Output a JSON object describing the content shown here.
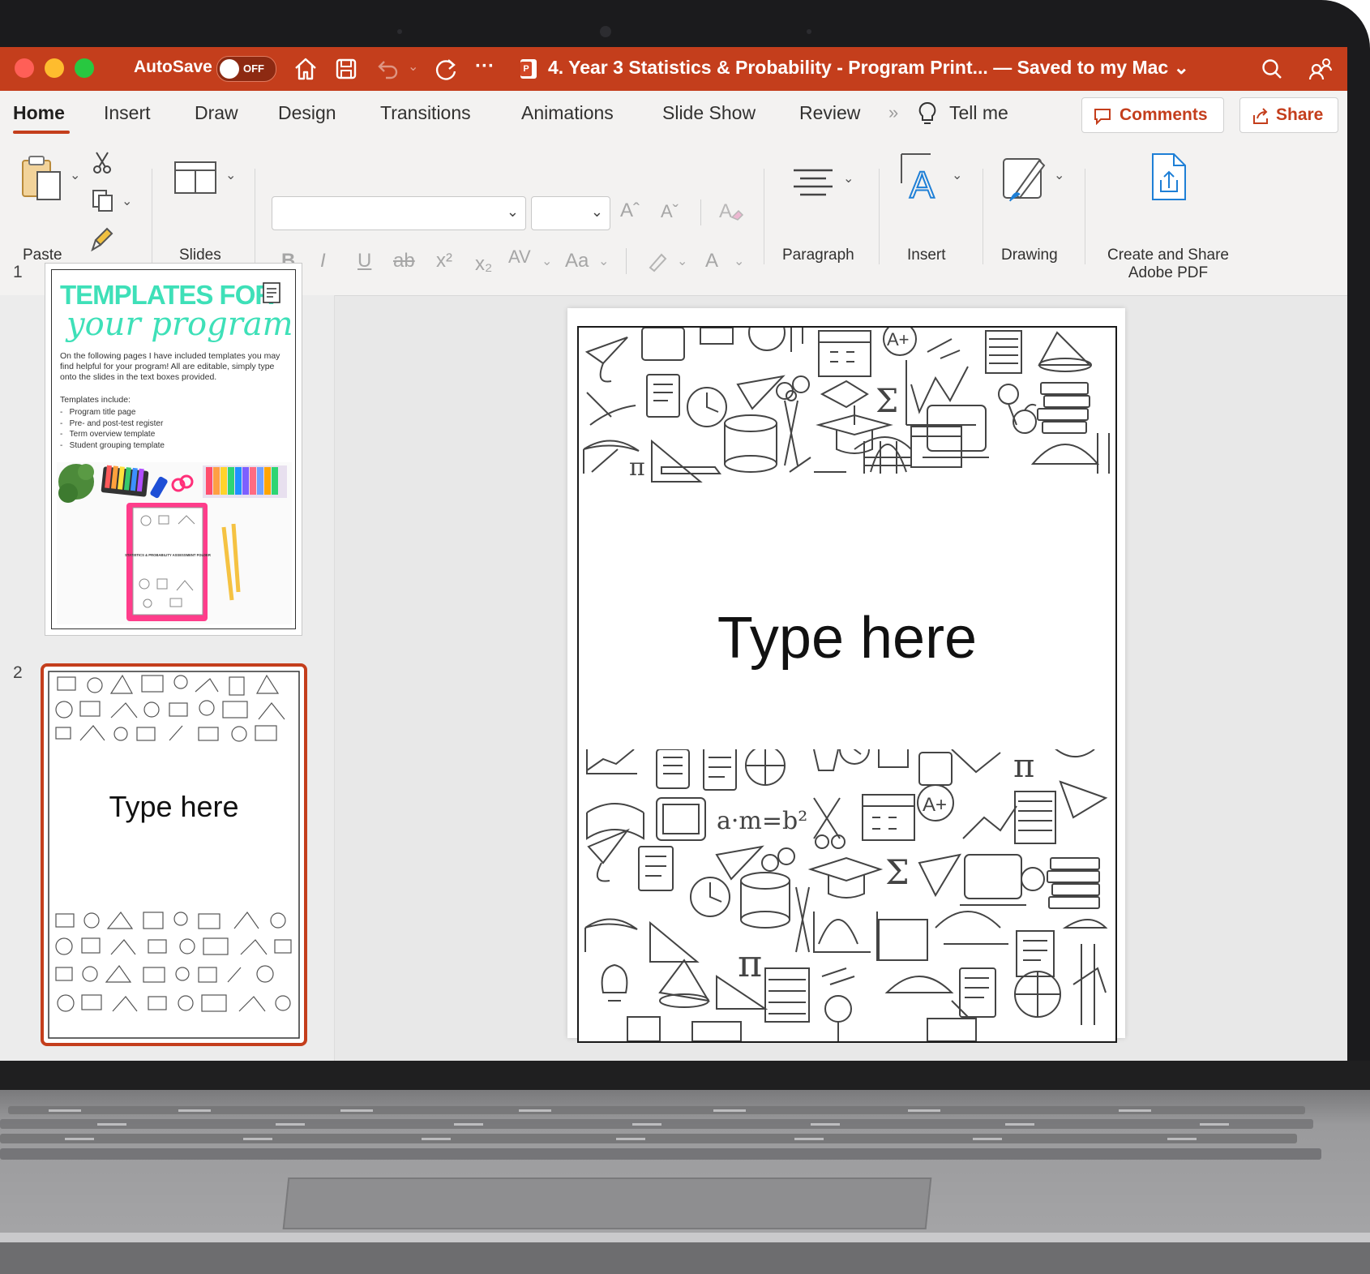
{
  "titlebar": {
    "autosave_label": "AutoSave",
    "autosave_state": "OFF",
    "document_title": "4. Year 3 Statistics & Probability - Program Print... — Saved to my Mac ⌄"
  },
  "tabs": [
    {
      "label": "Home"
    },
    {
      "label": "Insert"
    },
    {
      "label": "Draw"
    },
    {
      "label": "Design"
    },
    {
      "label": "Transitions"
    },
    {
      "label": "Animations"
    },
    {
      "label": "Slide Show"
    },
    {
      "label": "Review"
    }
  ],
  "tell_me": "Tell me",
  "comments_label": "Comments",
  "share_label": "Share",
  "ribbon": {
    "paste": "Paste",
    "slides": "Slides",
    "paragraph": "Paragraph",
    "insert": "Insert",
    "drawing": "Drawing",
    "adobe_line1": "Create and Share",
    "adobe_line2": "Adobe PDF",
    "format": {
      "bold": "B",
      "italic": "I",
      "underline": "U",
      "strike": "ab",
      "superscript": "x²",
      "subscript": "x₂",
      "spacing": "AV",
      "change_case": "Aa",
      "grow": "Aˆ",
      "shrink": "Aˇ",
      "font_color": "A"
    }
  },
  "thumbnails": [
    {
      "number": "1",
      "title_line1": "TEMPLATES FOR",
      "title_line2": "your program",
      "intro": "On the following pages I have included templates you may find helpful for your program! All are editable, simply type onto the slides in the text boxes provided.",
      "includes_label": "Templates include:",
      "items": [
        "Program title page",
        "Pre- and post-test register",
        "Term overview template",
        "Student grouping template"
      ],
      "binder_text": "STATISTICS & PROBABILITY ASSESSMENT FOLDER"
    },
    {
      "number": "2",
      "text": "Type here"
    }
  ],
  "slide": {
    "text": "Type here",
    "formula": "a·m=b²"
  },
  "colors": {
    "accent": "#c43e1c",
    "teal": "#3ee0b8"
  }
}
